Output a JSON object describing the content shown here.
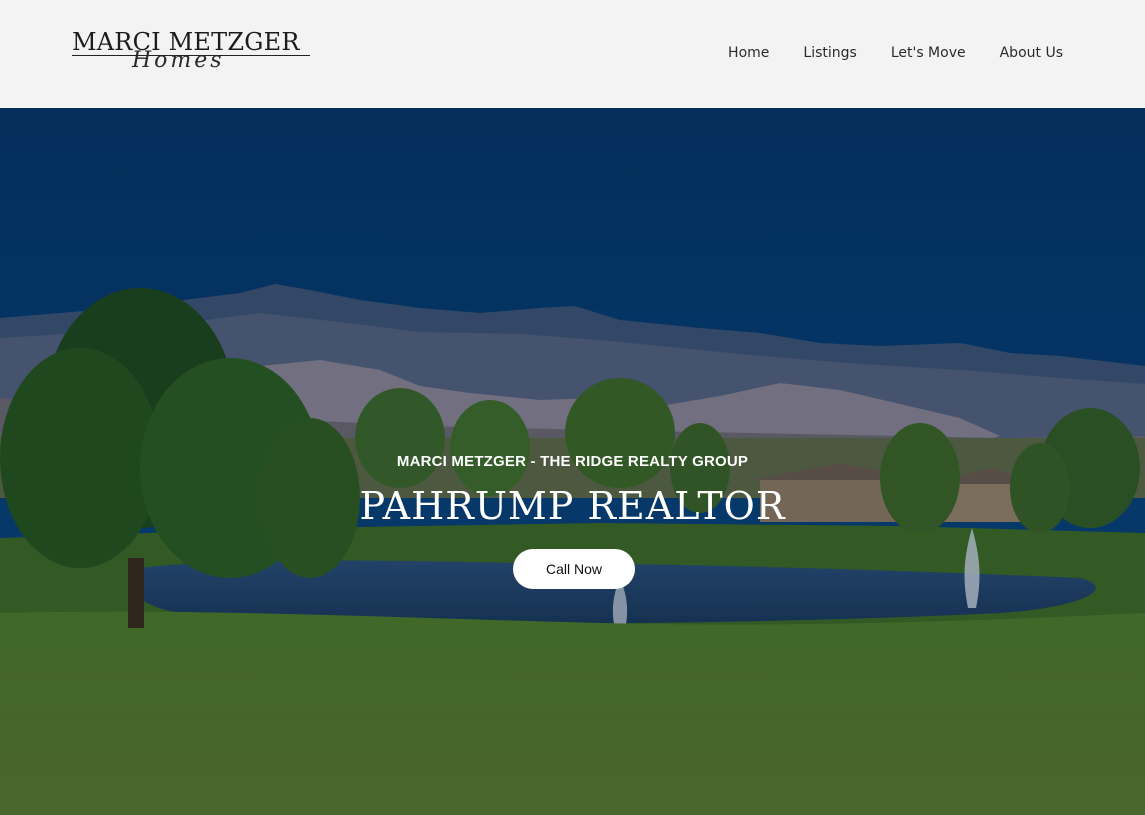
{
  "header": {
    "logo": {
      "name": "MARCI METZGER",
      "script": "Homes"
    },
    "nav": [
      {
        "label": "Home"
      },
      {
        "label": "Listings"
      },
      {
        "label": "Let's Move"
      },
      {
        "label": "About Us"
      }
    ]
  },
  "hero": {
    "subtitle": "MARCI METZGER - THE RIDGE REALTY GROUP",
    "title": "PAHRUMP REALTOR",
    "cta_label": "Call Now"
  },
  "colors": {
    "header_bg": "#f3f3f3",
    "sky": "#073a6e",
    "grass": "#4f7a2c",
    "button_bg": "#ffffff"
  }
}
